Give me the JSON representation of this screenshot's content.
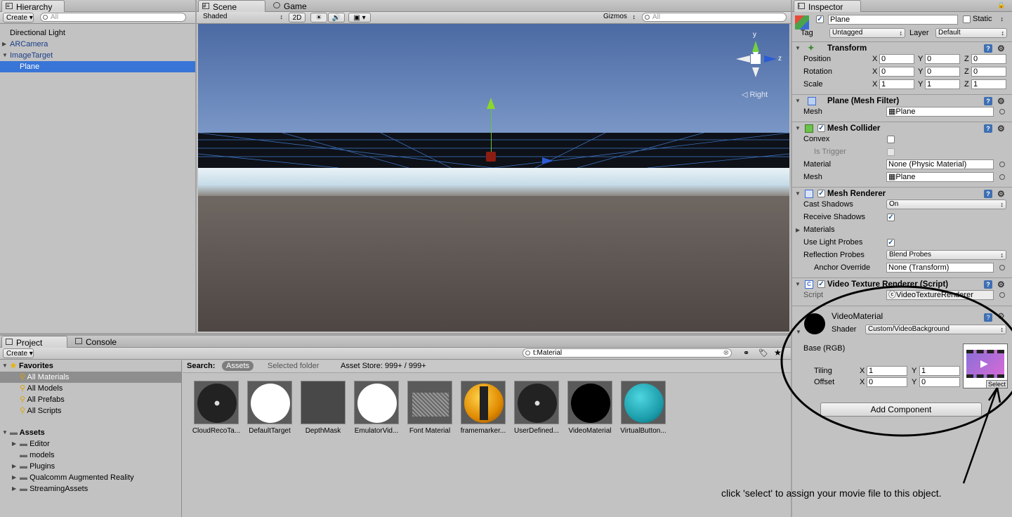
{
  "hierarchy": {
    "tab": "Hierarchy",
    "create": "Create",
    "search_placeholder": "All",
    "items": [
      {
        "label": "Directional Light"
      },
      {
        "label": "ARCamera"
      },
      {
        "label": "ImageTarget"
      },
      {
        "label": "Plane"
      }
    ]
  },
  "scene": {
    "tab_scene": "Scene",
    "tab_game": "Game",
    "shading": "Shaded",
    "mode_2d": "2D",
    "gizmos": "Gizmos",
    "search_placeholder": "All",
    "axis_y": "y",
    "axis_z": "z",
    "view_label": "Right"
  },
  "project": {
    "tab_project": "Project",
    "tab_console": "Console",
    "create": "Create",
    "search_value": "t:Material",
    "search_label": "Search:",
    "scope_assets": "Assets",
    "scope_selected": "Selected folder",
    "asset_store": "Asset Store: 999+ / 999+",
    "favorites_label": "Favorites",
    "favorites": [
      "All Materials",
      "All Models",
      "All Prefabs",
      "All Scripts"
    ],
    "assets_label": "Assets",
    "folders": [
      "Editor",
      "models",
      "Plugins",
      "Qualcomm Augmented Reality",
      "StreamingAssets"
    ],
    "materials": [
      "CloudRecoTa...",
      "DefaultTarget",
      "DepthMask",
      "EmulatorVid...",
      "Font Material",
      "framemarker...",
      "UserDefined...",
      "VideoMaterial",
      "VirtualButton..."
    ]
  },
  "inspector": {
    "tab": "Inspector",
    "object_name": "Plane",
    "static_label": "Static",
    "tag_label": "Tag",
    "tag_value": "Untagged",
    "layer_label": "Layer",
    "layer_value": "Default",
    "transform": {
      "title": "Transform",
      "position_label": "Position",
      "position": [
        "0",
        "0",
        "0"
      ],
      "rotation_label": "Rotation",
      "rotation": [
        "0",
        "0",
        "0"
      ],
      "scale_label": "Scale",
      "scale": [
        "1",
        "1",
        "1"
      ],
      "x": "X",
      "y": "Y",
      "z": "Z"
    },
    "mesh_filter": {
      "title": "Plane (Mesh Filter)",
      "mesh_label": "Mesh",
      "mesh_value": "Plane"
    },
    "mesh_collider": {
      "title": "Mesh Collider",
      "convex_label": "Convex",
      "trigger_label": "Is Trigger",
      "material_label": "Material",
      "material_value": "None (Physic Material)",
      "mesh_label": "Mesh",
      "mesh_value": "Plane"
    },
    "mesh_renderer": {
      "title": "Mesh Renderer",
      "cast_label": "Cast Shadows",
      "cast_value": "On",
      "receive_label": "Receive Shadows",
      "materials_label": "Materials",
      "probes_label": "Use Light Probes",
      "reflection_label": "Reflection Probes",
      "reflection_value": "Blend Probes",
      "anchor_label": "Anchor Override",
      "anchor_value": "None (Transform)"
    },
    "video_script": {
      "title": "Video Texture Renderer (Script)",
      "script_label": "Script",
      "script_value": "VideoTextureRenderer"
    },
    "material": {
      "name": "VideoMaterial",
      "shader_label": "Shader",
      "shader_value": "Custom/VideoBackground",
      "base_label": "Base (RGB)",
      "tiling_label": "Tiling",
      "tiling_x": "1",
      "tiling_y": "1",
      "offset_label": "Offset",
      "offset_x": "0",
      "offset_y": "0",
      "select": "Select"
    },
    "add_component": "Add Component"
  },
  "annotation": {
    "text": "click 'select' to assign your movie file to this object."
  }
}
